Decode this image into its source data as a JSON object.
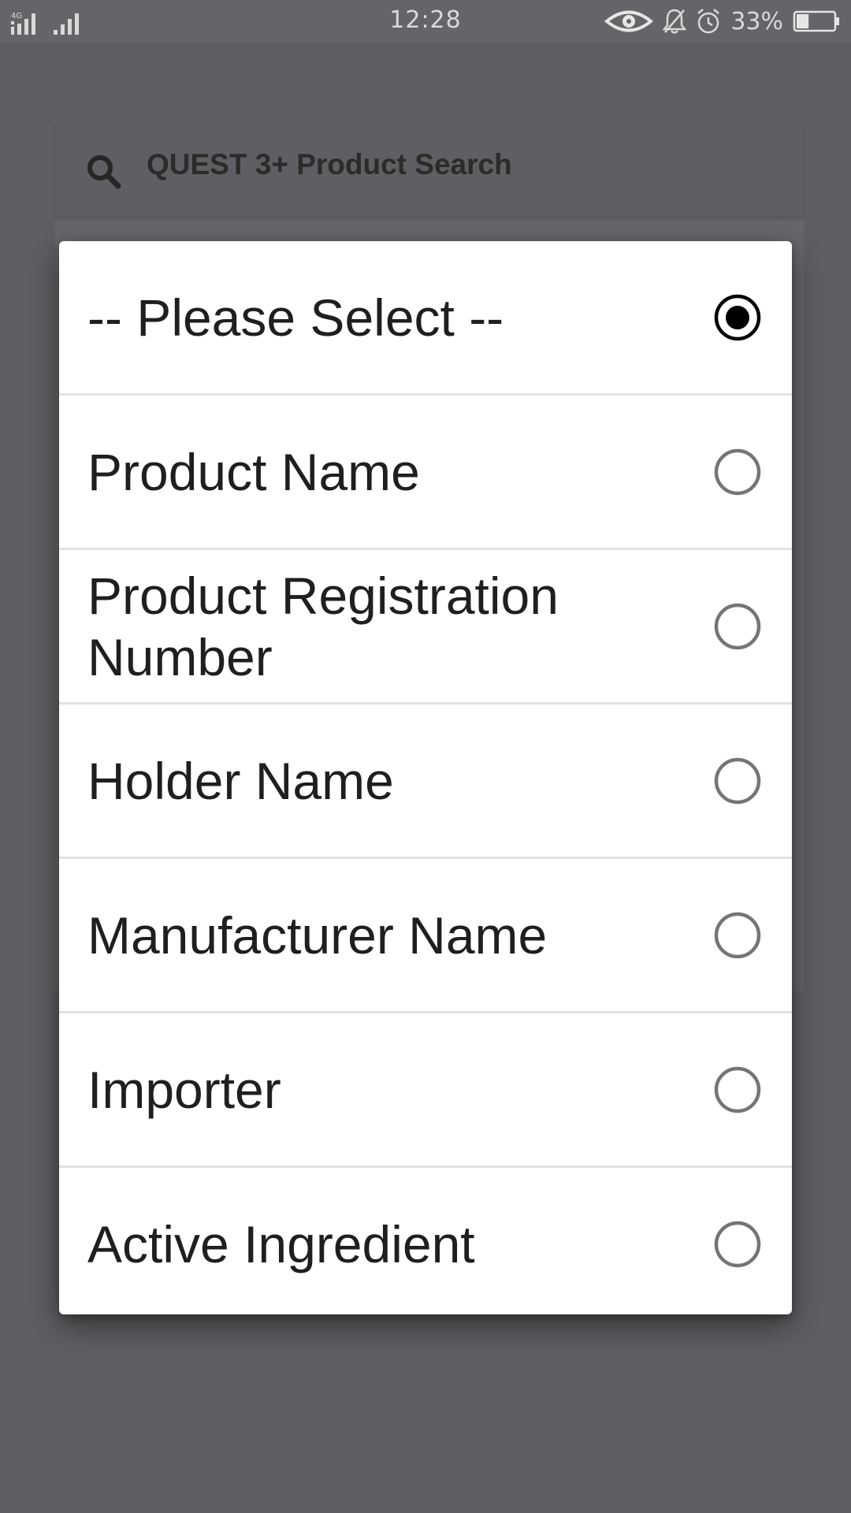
{
  "status_bar": {
    "network_label": "4G",
    "time": "12:28",
    "battery_percent": "33%",
    "battery_level": 0.33,
    "icons": [
      "signal-icon",
      "signal-icon",
      "eye-icon",
      "bell-muted-icon",
      "alarm-icon",
      "battery-icon"
    ]
  },
  "search": {
    "label": "QUEST 3+ Product Search",
    "icon": "search-icon"
  },
  "dialog": {
    "selected_index": 0,
    "options": [
      {
        "label": "-- Please Select --",
        "selected": true
      },
      {
        "label": "Product Name",
        "selected": false
      },
      {
        "label": "Product Registration Number",
        "selected": false
      },
      {
        "label": "Holder Name",
        "selected": false
      },
      {
        "label": "Manufacturer Name",
        "selected": false
      },
      {
        "label": "Importer",
        "selected": false
      },
      {
        "label": "Active Ingredient",
        "selected": false
      }
    ]
  },
  "colors": {
    "scrim": "#5f5e62",
    "radio_selected": "#000000",
    "radio_unselected": "#757575",
    "dialog_bg": "#ffffff",
    "text": "#1f1f1f"
  }
}
